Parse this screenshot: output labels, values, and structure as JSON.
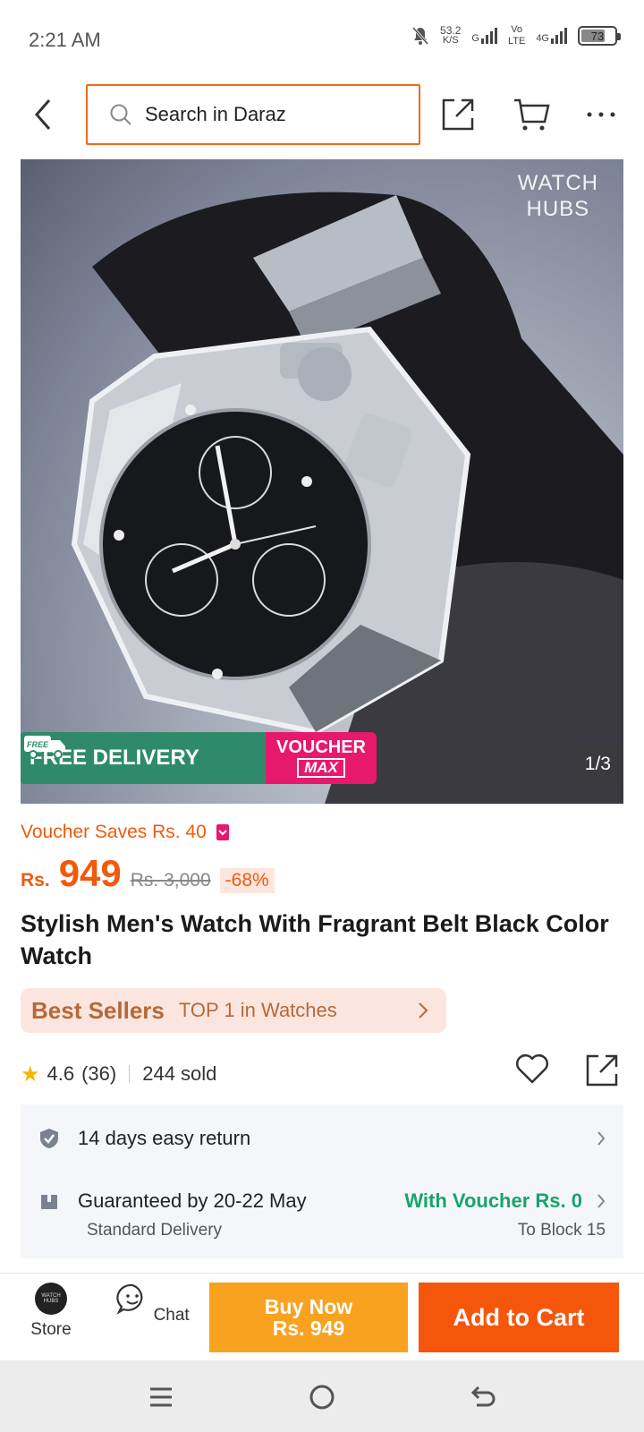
{
  "status_bar": {
    "time": "2:21 AM",
    "net_speed_value": "53.2",
    "net_speed_unit": "K/S",
    "sim1_label": "G",
    "volte_top": "Vo",
    "volte_bottom": "LTE",
    "network_label": "4G",
    "battery_level": "73"
  },
  "header": {
    "search_placeholder": "Search in Daraz",
    "accent_color": "#f06a14"
  },
  "product_image": {
    "brand_mark_line1": "WATCH",
    "brand_mark_line2": "HUBS",
    "free_delivery_badge": "FREE",
    "free_delivery_label": "FREE DELIVERY",
    "voucher_label": "VOUCHER",
    "voucher_max": "MAX",
    "counter": "1/3"
  },
  "pricing": {
    "voucher_saves": "Voucher Saves Rs. 40",
    "currency": "Rs.",
    "price": "949",
    "original_price": "Rs. 3,000",
    "discount": "-68%"
  },
  "product": {
    "title": "Stylish Men's Watch With Fragrant Belt Black Color Watch"
  },
  "best_sellers": {
    "label": "Best Sellers",
    "text": "TOP 1 in Watches"
  },
  "rating": {
    "score": "4.6",
    "count": "(36)",
    "sold": "244 sold"
  },
  "services": {
    "return_text": "14 days easy return",
    "delivery_text": "Guaranteed by 20-22 May",
    "delivery_voucher": "With Voucher Rs. 0",
    "delivery_type": "Standard Delivery",
    "delivery_location": "To Block 15"
  },
  "action_bar": {
    "store_label": "Store",
    "store_avatar_text": "WATCH HUBS",
    "chat_label": "Chat",
    "buy_now_label": "Buy Now",
    "buy_now_price": "Rs. 949",
    "add_to_cart_label": "Add to Cart",
    "buy_now_color": "#f8a21f",
    "add_to_cart_color": "#f5560c"
  }
}
